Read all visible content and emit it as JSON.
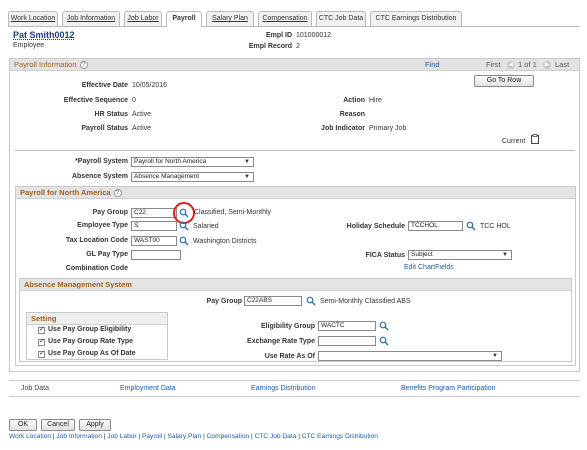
{
  "tabs": [
    {
      "label": "Work Location",
      "active": false
    },
    {
      "label": "Job Information",
      "active": false
    },
    {
      "label": "Job Labor",
      "active": false
    },
    {
      "label": "Payroll",
      "active": true
    },
    {
      "label": "Salary Plan",
      "active": false
    },
    {
      "label": "Compensation",
      "active": false
    },
    {
      "label": "CTC Job Data",
      "active": false
    },
    {
      "label": "CTC Earnings Distribution",
      "active": false
    }
  ],
  "header": {
    "employee_name": "Pat Smith0012",
    "employee_label": "Employee",
    "empl_id_label": "Empl ID",
    "empl_id_value": "101000012",
    "empl_record_label": "Empl Record",
    "empl_record_value": "2"
  },
  "payroll_info": {
    "title": "Payroll Information",
    "find": "Find",
    "first": "First",
    "pager": "1 of 1",
    "last": "Last",
    "go_to_row": "Go To Row",
    "effective_date_label": "Effective Date",
    "effective_date_value": "10/05/2016",
    "effective_sequence_label": "Effective Sequence",
    "effective_sequence_value": "0",
    "hr_status_label": "HR Status",
    "hr_status_value": "Active",
    "payroll_status_label": "Payroll Status",
    "payroll_status_value": "Active",
    "action_label": "Action",
    "action_value": "Hire",
    "reason_label": "Reason",
    "reason_value": "",
    "job_indicator_label": "Job Indicator",
    "job_indicator_value": "Primary Job",
    "current": "Current",
    "payroll_system_label": "*Payroll System",
    "payroll_system_value": "Payroll for North America",
    "absence_system_label": "Absence System",
    "absence_system_value": "Absence Management"
  },
  "pna": {
    "title": "Payroll for North America",
    "pay_group_label": "Pay Group",
    "pay_group_value": "C22",
    "pay_group_desc": "Classified, Semi-Monthly",
    "employee_type_label": "Employee Type",
    "employee_type_value": "S",
    "employee_type_desc": "Salaried",
    "tax_location_label": "Tax Location Code",
    "tax_location_value": "WAST00",
    "tax_location_desc": "Washington Districts",
    "gl_pay_type_label": "GL Pay Type",
    "gl_pay_type_value": "",
    "combination_code_label": "Combination Code",
    "holiday_schedule_label": "Holiday Schedule",
    "holiday_schedule_value": "TCCHOL",
    "holiday_schedule_desc": "TCC HOL",
    "fica_status_label": "FICA Status",
    "fica_status_value": "Subject",
    "edit_chartfields": "Edit ChartFields"
  },
  "absence": {
    "title": "Absence Management System",
    "pay_group_label": "Pay Group",
    "pay_group_value": "C22ABS",
    "pay_group_desc": "Semi-Monthly Classified ABS",
    "setting_title": "Setting",
    "cb1": "Use Pay Group Eligibility",
    "cb2": "Use Pay Group Rate Type",
    "cb3": "Use Pay Group As Of Date",
    "eligibility_group_label": "Eligibility Group",
    "eligibility_group_value": "WACTC",
    "exchange_rate_label": "Exchange Rate Type",
    "exchange_rate_value": "",
    "use_rate_label": "Use Rate As Of",
    "use_rate_value": ""
  },
  "bottom_links": {
    "job_data": "Job Data",
    "employment_data": "Employment Data",
    "earnings_distribution": "Earnings Distribution",
    "benefits": "Benefits Program Participation"
  },
  "buttons": {
    "ok": "OK",
    "cancel": "Cancel",
    "apply": "Apply"
  },
  "footer_links": [
    "Work Location",
    "Job Information",
    "Job Labor",
    "Payroll",
    "Salary Plan",
    "Compensation",
    "CTC Job Data",
    "CTC Earnings Distribution"
  ],
  "footer_sep": " | "
}
